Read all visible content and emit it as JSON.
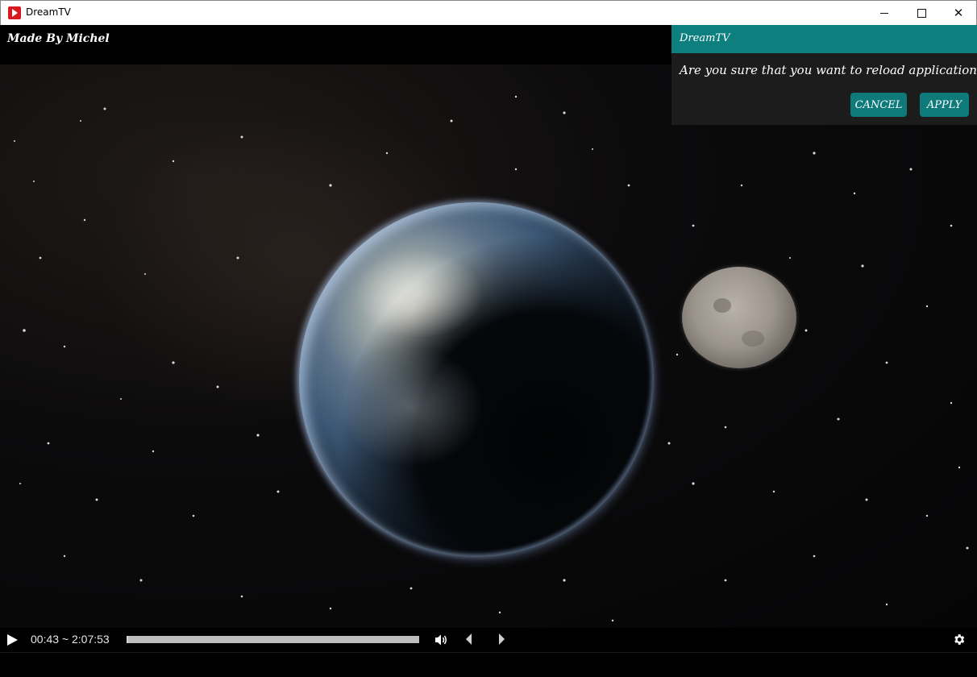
{
  "window": {
    "title": "DreamTV",
    "app_icon": "play-logo-icon",
    "controls": [
      "minimize-icon",
      "maximize-icon",
      "close-icon"
    ]
  },
  "overlay": {
    "credit": "Made By Michel"
  },
  "dialog": {
    "title": "DreamTV",
    "message": "Are you sure that you want to reload application ?",
    "cancel_label": "CANCEL",
    "apply_label": "APPLY",
    "accent_color": "#0e7f7f"
  },
  "player": {
    "time_display": "00:43 ~ 2:07:53",
    "progress_fraction": 0.0057,
    "icons": [
      "play-icon",
      "volume-icon",
      "previous-icon",
      "next-icon",
      "settings-icon"
    ]
  }
}
